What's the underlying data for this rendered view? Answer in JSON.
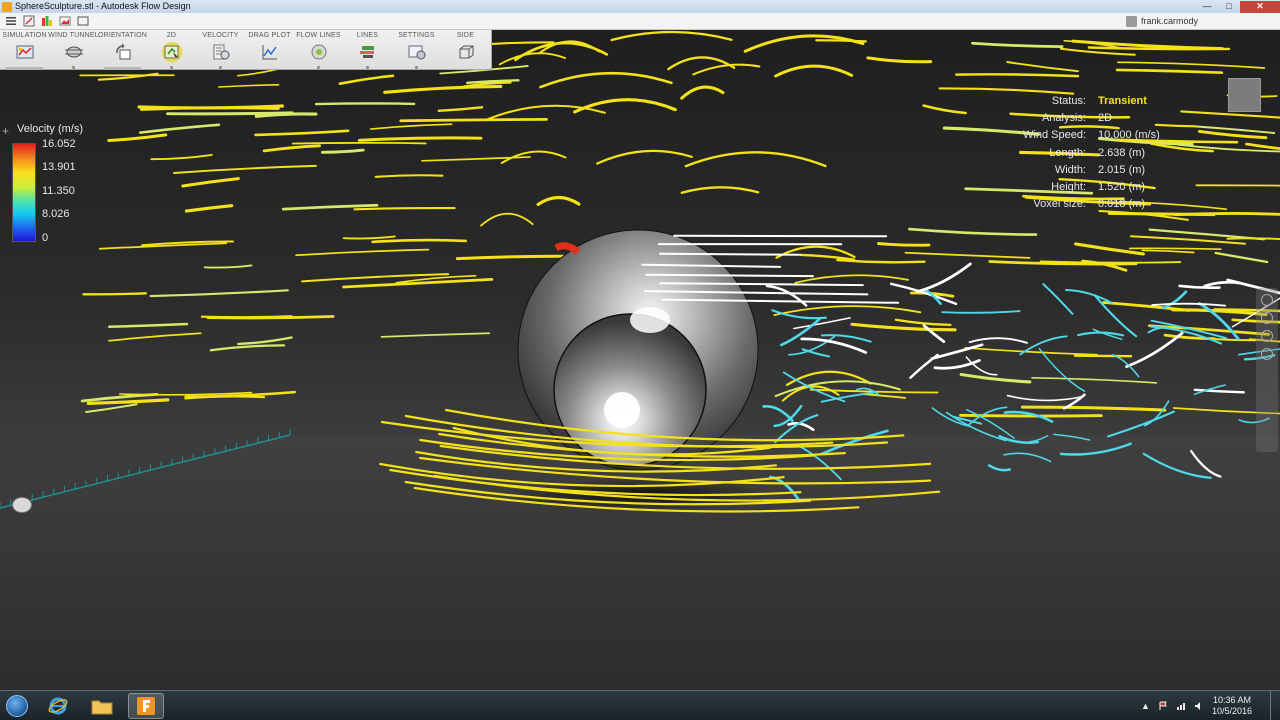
{
  "window": {
    "title": "SphereSculpture.stl - Autodesk Flow Design",
    "user": "frank.carmody"
  },
  "ribbon": {
    "items": [
      {
        "label": "SIMULATION",
        "icon": "simulation-icon"
      },
      {
        "label": "WIND TUNNEL",
        "icon": "wind-tunnel-icon"
      },
      {
        "label": "ORIENTATION",
        "icon": "orientation-icon"
      },
      {
        "label": "2D",
        "icon": "2d-icon",
        "active": true
      },
      {
        "label": "VELOCITY",
        "icon": "velocity-icon"
      },
      {
        "label": "DRAG PLOT",
        "icon": "drag-plot-icon"
      },
      {
        "label": "FLOW LINES",
        "icon": "flow-lines-icon"
      },
      {
        "label": "LINES",
        "icon": "lines-icon"
      },
      {
        "label": "SETTINGS",
        "icon": "settings-icon"
      },
      {
        "label": "SIDE",
        "icon": "side-view-icon"
      }
    ]
  },
  "legend": {
    "title": "Velocity (m/s)",
    "ticks": [
      "16.052",
      "13.901",
      "11.350",
      "8.026",
      "0"
    ]
  },
  "info": {
    "rows": [
      {
        "key": "Status:",
        "value": "Transient"
      },
      {
        "key": "Analysis:",
        "value": "2D"
      },
      {
        "key": "Wind Speed:",
        "value": "10.000 (m/s)"
      },
      {
        "key": "Length:",
        "value": "2.638 (m)"
      },
      {
        "key": "Width:",
        "value": "2.015 (m)"
      },
      {
        "key": "Height:",
        "value": "1.520 (m)"
      },
      {
        "key": "Voxel size:",
        "value": "0.018 (m)"
      }
    ]
  },
  "taskbar": {
    "time": "10:36 AM",
    "date": "10/5/2016"
  },
  "colors": {
    "flow_fast": "#f3e21a",
    "flow_mid": "#d8e86a",
    "flow_slow": "#4fd8e8",
    "flow_white": "#ffffff",
    "hotspot": "#e0301a"
  }
}
